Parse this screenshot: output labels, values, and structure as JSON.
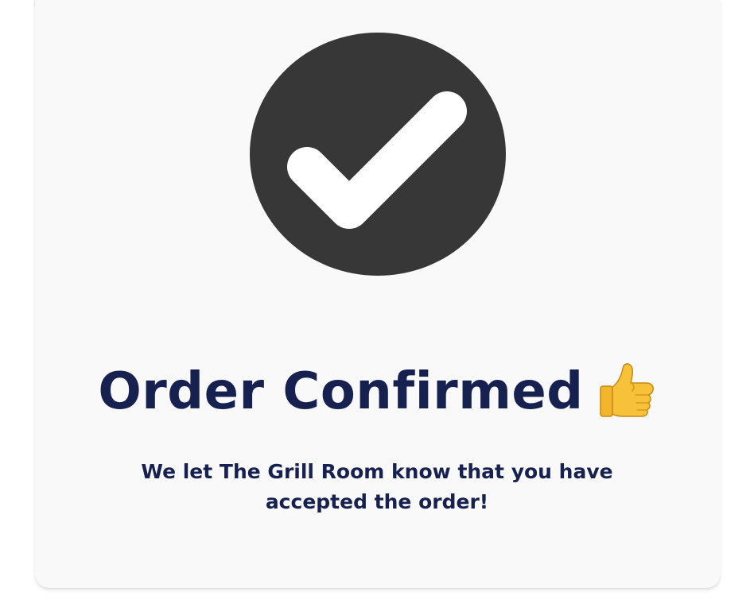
{
  "confirmation": {
    "title": "Order Confirmed",
    "title_emoji": "thumbs-up-icon",
    "message_line1": "We let The Grill Room know that you have",
    "message_line2": "accepted the order!"
  },
  "colors": {
    "title": "#16214f",
    "check_circle": "#373737",
    "check_mark": "#ffffff",
    "card_background": "#f9f9fa"
  }
}
